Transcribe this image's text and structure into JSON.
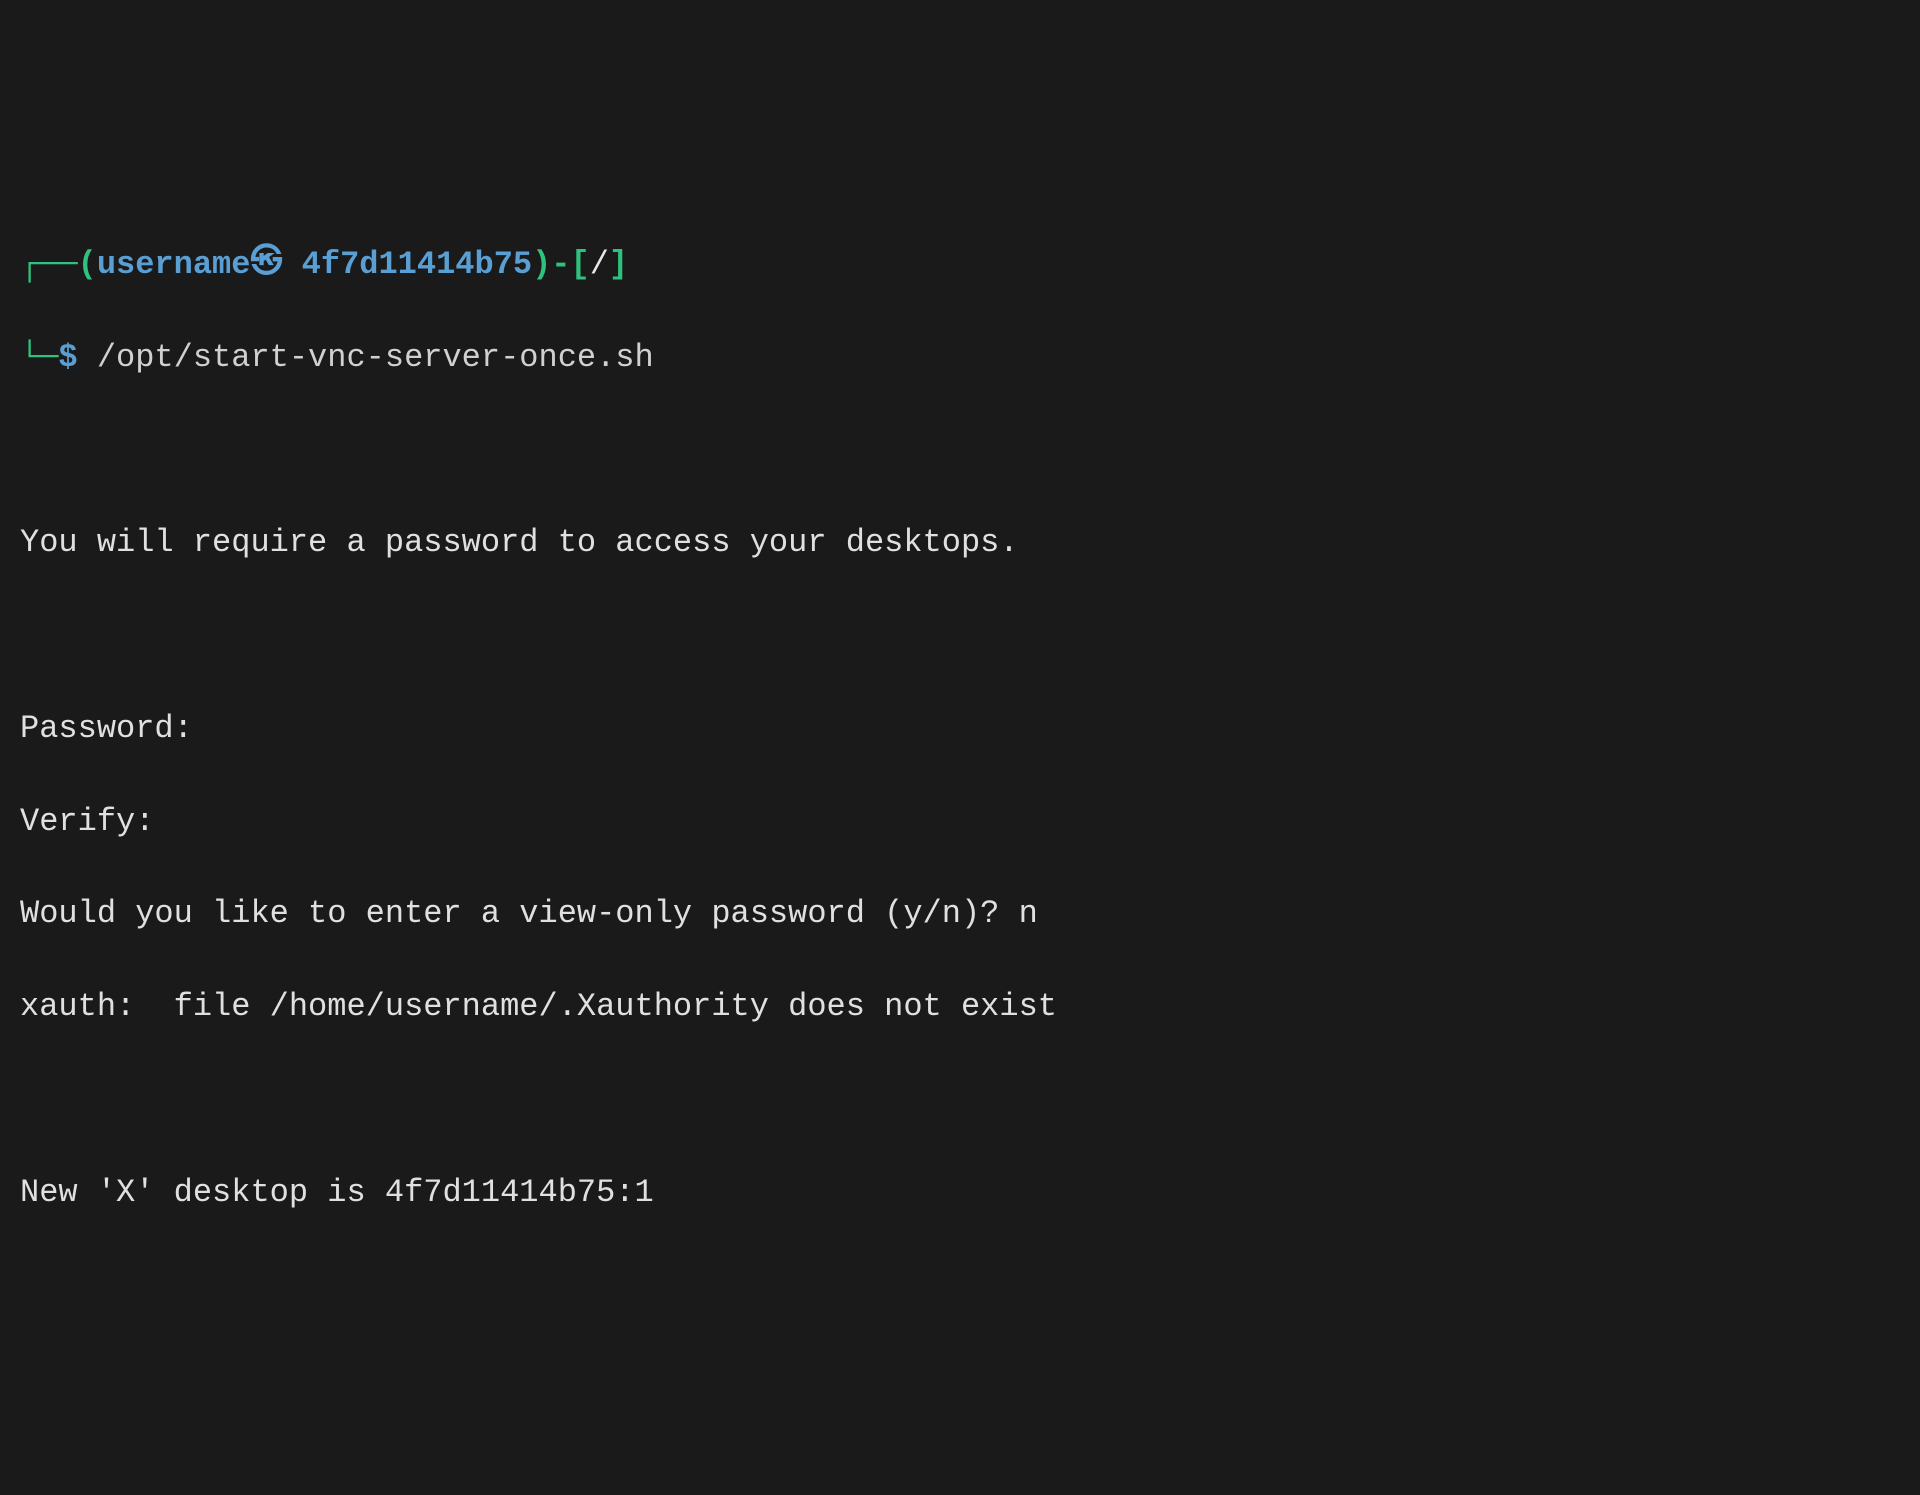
{
  "prompt": {
    "box_top_left": "┌──",
    "paren_open": "(",
    "username": "username",
    "badge_char": "㉿",
    "separator": " ",
    "hostname": "4f7d11414b75",
    "paren_close": ")",
    "dash": "-",
    "bracket_open": "[",
    "path": "/",
    "bracket_close": "]",
    "box_bottom_left": "└─",
    "dollar": "$",
    "command": "/opt/start-vnc-server-once.sh"
  },
  "output": {
    "line1": "You will require a password to access your desktops.",
    "line2": "Password:",
    "line3": "Verify:",
    "line4_prompt": "Would you like to enter a view-only password (y/n)? ",
    "line4_answer": "n",
    "line5": "xauth:  file /home/username/.Xauthority does not exist",
    "line6": "New 'X' desktop is 4f7d11414b75:1"
  }
}
